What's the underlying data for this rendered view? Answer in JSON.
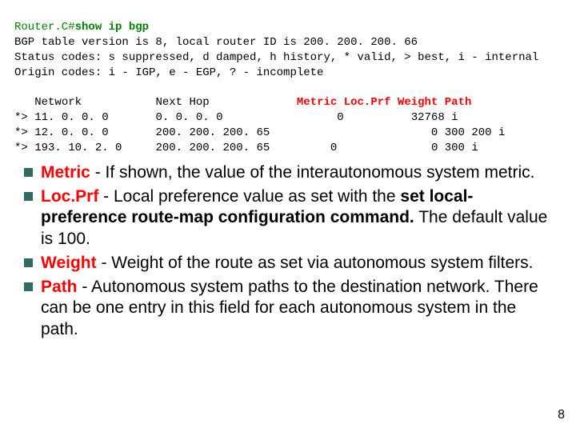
{
  "terminal": {
    "prompt": "Router.C#",
    "command": "show ip bgp",
    "line_version": "BGP table version is 8, local router ID is 200. 200. 200. 66",
    "line_status": "Status codes: s suppressed, d damped, h history, * valid, > best, i - internal",
    "line_origin": "Origin codes: i - IGP, e - EGP, ? - incomplete",
    "cols": {
      "network": "Network",
      "nexthop": "Next Hop",
      "metric": "Metric",
      "locprf": "Loc.Prf",
      "weight": "Weight",
      "path": "Path"
    },
    "rows": [
      {
        "mark": "*>",
        "network": "11. 0. 0. 0",
        "nexthop": "0. 0. 0. 0",
        "metric": "0",
        "locprf": "",
        "weight": "32768",
        "path": "i"
      },
      {
        "mark": "*>",
        "network": "12. 0. 0. 0",
        "nexthop": "200. 200. 200. 65",
        "metric": "",
        "locprf": "",
        "weight": "0",
        "path": "300 200 i"
      },
      {
        "mark": "*>",
        "network": "193. 10. 2. 0",
        "nexthop": "200. 200. 200. 65",
        "metric": "0",
        "locprf": "",
        "weight": "0",
        "path": "300 i"
      }
    ]
  },
  "bullets": [
    {
      "term": "Metric",
      "text": " - If shown, the value of the interautonomous system metric."
    },
    {
      "term": "Loc.Prf",
      "pre": " - Local preference value as set with the ",
      "bold": "set local-preference route-map configuration command.",
      "post": " The default value is 100."
    },
    {
      "term": "Weight",
      "text": " - Weight of the route as set via autonomous system filters."
    },
    {
      "term": "Path",
      "text": " - Autonomous system paths to the destination network. There can be one entry in this field for each autonomous system in the path."
    }
  ],
  "page_number": "8"
}
